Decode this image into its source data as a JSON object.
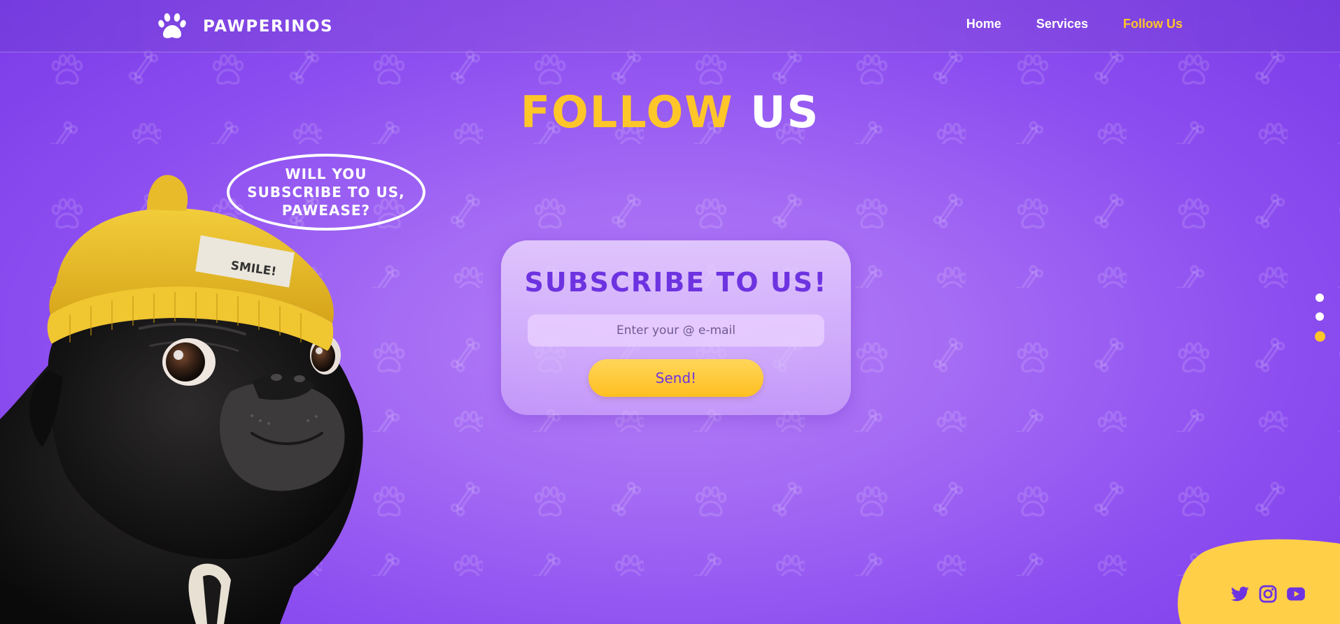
{
  "brand": {
    "name": "PAWPERINOS",
    "logo_icon": "paw-icon"
  },
  "nav": {
    "items": [
      {
        "label": "Home",
        "active": false
      },
      {
        "label": "Services",
        "active": false
      },
      {
        "label": "Follow Us",
        "active": true
      }
    ]
  },
  "hero": {
    "title_part1": "FOLLOW",
    "title_part2": "US"
  },
  "bubble": {
    "text": "WILL YOU SUBSCRIBE TO US, PAWEASE?"
  },
  "subscribe": {
    "title": "SUBSCRIBE TO US!",
    "email_placeholder": "Enter your @ e-mail",
    "email_value": "",
    "send_label": "Send!"
  },
  "pager": {
    "count": 3,
    "active_index": 2
  },
  "social": {
    "icons": [
      "twitter-icon",
      "instagram-icon",
      "youtube-icon"
    ]
  },
  "colors": {
    "accent_yellow": "#ffc629",
    "purple": "#6d33e0",
    "background": "#9b5cf2",
    "white": "#ffffff"
  }
}
